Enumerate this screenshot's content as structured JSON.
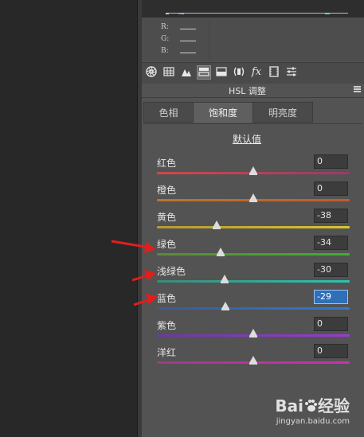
{
  "rgb_readout": {
    "r_label": "R:",
    "g_label": "G:",
    "b_label": "B:"
  },
  "toolbar": {
    "icons": [
      "aperture-icon",
      "grid-icon",
      "mountain-icon",
      "hsl-icon",
      "split-tone-icon",
      "lens-icon",
      "fx-icon",
      "film-icon",
      "sliders-icon"
    ],
    "active_index": 3
  },
  "panel": {
    "title": "HSL 调整"
  },
  "tabs": [
    {
      "label": "色相",
      "active": false
    },
    {
      "label": "饱和度",
      "active": true
    },
    {
      "label": "明亮度",
      "active": false
    }
  ],
  "default_link": "默认值",
  "sliders": [
    {
      "label": "红色",
      "value": "0",
      "level": 0,
      "gradient": [
        "#cf4a4a",
        "#9a3a6a"
      ],
      "focused": false
    },
    {
      "label": "橙色",
      "value": "0",
      "level": 0,
      "gradient": [
        "#b8762e",
        "#c45a2a"
      ],
      "focused": false
    },
    {
      "label": "黄色",
      "value": "-38",
      "level": -38,
      "gradient": [
        "#b59a32",
        "#d6c62e"
      ],
      "focused": false
    },
    {
      "label": "绿色",
      "value": "-34",
      "level": -34,
      "gradient": [
        "#5a8a3a",
        "#3fae2e"
      ],
      "focused": false
    },
    {
      "label": "浅绿色",
      "value": "-30",
      "level": -30,
      "gradient": [
        "#3a8a7a",
        "#2ec2b0"
      ],
      "focused": false
    },
    {
      "label": "蓝色",
      "value": "-29",
      "level": -29,
      "gradient": [
        "#3a5a9a",
        "#2e7ad6"
      ],
      "focused": true
    },
    {
      "label": "紫色",
      "value": "0",
      "level": 0,
      "gradient": [
        "#6a3aa0",
        "#9a3ad0"
      ],
      "focused": false
    },
    {
      "label": "洋红",
      "value": "0",
      "level": 0,
      "gradient": [
        "#a03a8a",
        "#d02eb0"
      ],
      "focused": false
    }
  ],
  "annotations": {
    "arrow_color": "#e01e1e",
    "arrow_targets": [
      "绿色",
      "浅绿色",
      "蓝色"
    ]
  },
  "watermark": {
    "main_before": "Bai",
    "main_after": "经验",
    "sub": "jingyan.baidu.com"
  }
}
